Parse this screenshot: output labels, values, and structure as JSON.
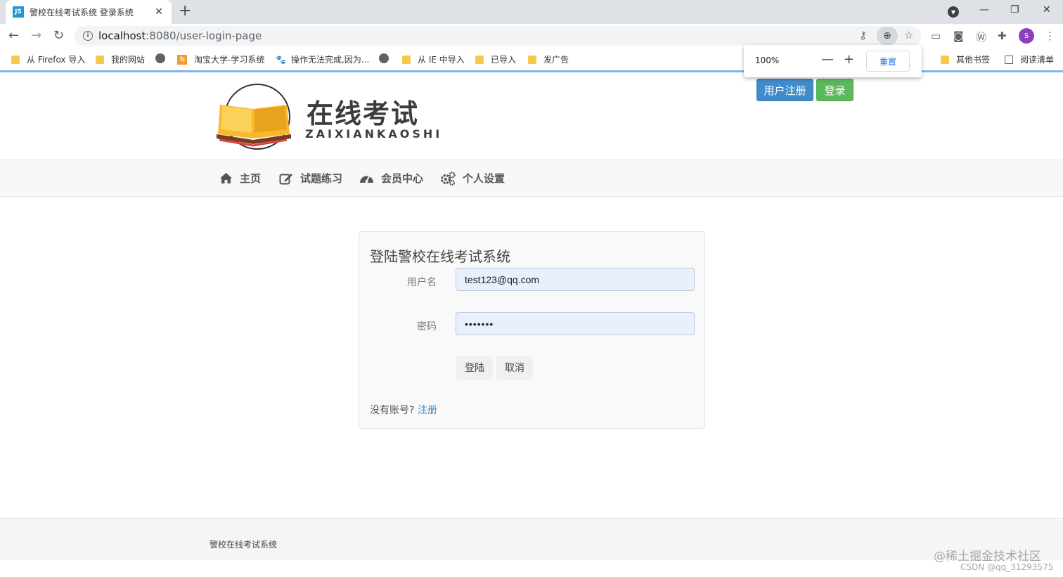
{
  "browser": {
    "tab_title": "警校在线考试系统 登录系统",
    "tab_favicon": "JS",
    "url_host": "localhost",
    "url_rest": ":8080/user-login-page",
    "zoom": {
      "level": "100%",
      "reset_label": "重置"
    },
    "avatar_letter": "S",
    "bookmarks": [
      "从 Firefox 导入",
      "我的网站",
      "淘宝大学-学习系统",
      "操作无法完成,因为...",
      "从 IE 中导入",
      "已导入",
      "发广告"
    ],
    "bookmarks_right": [
      "其他书签",
      "阅读清单"
    ]
  },
  "header": {
    "logo_title": "在线考试",
    "logo_subtitle": "ZAIXIANKAOSHI",
    "register_button": "用户注册",
    "login_button": "登录"
  },
  "nav": {
    "items": [
      "主页",
      "试题练习",
      "会员中心",
      "个人设置"
    ]
  },
  "login_form": {
    "title": "登陆警校在线考试系统",
    "username_label": "用户名",
    "username_value": "test123@qq.com",
    "password_label": "密码",
    "password_value": "•••••••",
    "submit_label": "登陆",
    "cancel_label": "取消",
    "no_account_text": "没有账号?",
    "register_link": "注册"
  },
  "footer": {
    "text": "警校在线考试系统"
  },
  "watermark": {
    "line1": "@稀土掘金技术社区",
    "line2": "CSDN @qq_31293575"
  },
  "colors": {
    "primary": "#428bca",
    "success": "#5cb85c",
    "chrome_tabbar": "#dee1e6"
  }
}
